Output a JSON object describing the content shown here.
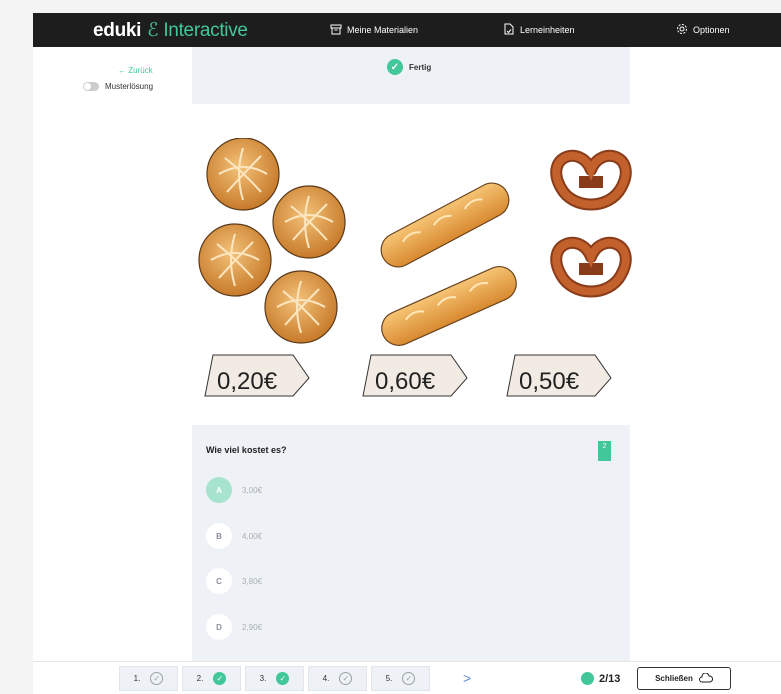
{
  "header": {
    "logo_main": "eduki",
    "logo_mark": "ℰ",
    "logo_sub": "Interactive",
    "nav": [
      {
        "label": "Meine Materialien",
        "icon": "archive-icon"
      },
      {
        "label": "Lerneinheiten",
        "icon": "document-icon"
      },
      {
        "label": "Optionen",
        "icon": "gear-icon"
      }
    ]
  },
  "sidebar": {
    "back_label": "← Zurück",
    "toggle_label": "Musterlösung"
  },
  "status": {
    "label": "Fertig"
  },
  "illustration": {
    "price_tags": [
      "0,20€",
      "0,60€",
      "0,50€"
    ],
    "items": [
      "bread-rolls",
      "baguettes",
      "pretzels"
    ]
  },
  "question": {
    "title": "Wie viel kostet es?",
    "bookmark_label": "2",
    "options": [
      {
        "letter": "A",
        "text": "3,00€",
        "selected": true
      },
      {
        "letter": "B",
        "text": "4,00€",
        "selected": false
      },
      {
        "letter": "C",
        "text": "3,80€",
        "selected": false
      },
      {
        "letter": "D",
        "text": "2,90€",
        "selected": false
      }
    ]
  },
  "footer": {
    "pages": [
      {
        "label": "1.",
        "done": false
      },
      {
        "label": "2.",
        "done": true
      },
      {
        "label": "3.",
        "done": true
      },
      {
        "label": "4.",
        "done": false
      },
      {
        "label": "5.",
        "done": false
      }
    ],
    "next_symbol": ">",
    "progress": "2/13",
    "close_label": "Schließen"
  },
  "colors": {
    "accent": "#41c79a",
    "topbar": "#1d1d1d",
    "panel": "#eef1f5"
  }
}
